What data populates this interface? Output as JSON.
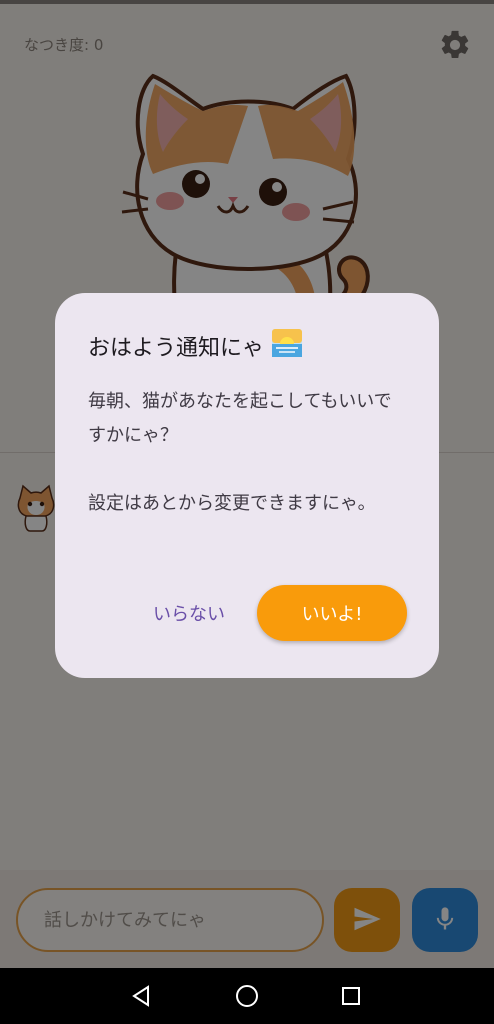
{
  "app": {
    "affinity_label": "なつき度: 0"
  },
  "dialog": {
    "title": "おはよう通知にゃ",
    "title_emoji": "sunrise-icon",
    "body_line1": "毎朝、猫があなたを起こしてもいいですかにゃ？",
    "body_line2": "設定はあとから変更できますにゃ。",
    "dismiss_label": "いらない",
    "confirm_label": "いいよ!"
  },
  "chat": {
    "input_placeholder": "話しかけてみてにゃ",
    "send_icon": "send-icon",
    "mic_icon": "mic-icon"
  },
  "icons": {
    "settings": "gear-icon",
    "nav_back": "back-triangle-icon",
    "nav_home": "home-circle-icon",
    "nav_recents": "recents-square-icon"
  },
  "colors": {
    "accent_orange": "#f99b0b",
    "accent_blue": "#2f8bdb",
    "dialog_bg": "#ece6f0",
    "dismiss_text": "#6a4fa8"
  }
}
